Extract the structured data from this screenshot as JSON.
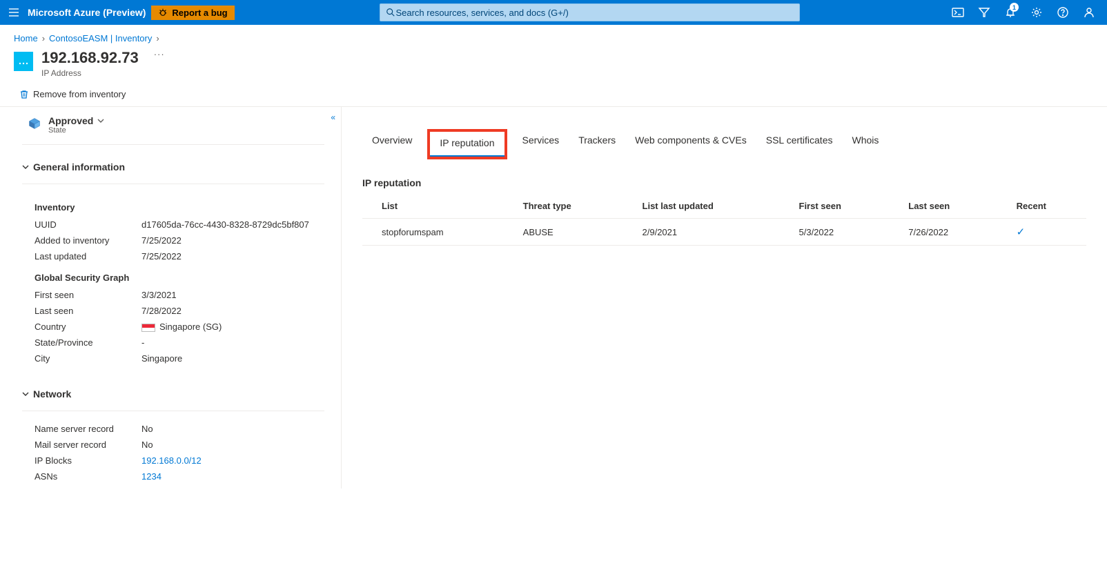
{
  "topbar": {
    "brand": "Microsoft Azure (Preview)",
    "bug_label": "Report a bug",
    "search_placeholder": "Search resources, services, and docs (G+/)",
    "notification_count": "1"
  },
  "breadcrumb": {
    "items": [
      "Home",
      "ContosoEASM | Inventory"
    ]
  },
  "page": {
    "title": "192.168.92.73",
    "subtitle": "IP Address",
    "remove_label": "Remove from inventory"
  },
  "state": {
    "value": "Approved",
    "label": "State"
  },
  "left": {
    "general_header": "General information",
    "inventory_header": "Inventory",
    "uuid_k": "UUID",
    "uuid_v": "d17605da-76cc-4430-8328-8729dc5bf807",
    "added_k": "Added to inventory",
    "added_v": "7/25/2022",
    "updated_k": "Last updated",
    "updated_v": "7/25/2022",
    "gsg_header": "Global Security Graph",
    "first_seen_k": "First seen",
    "first_seen_v": "3/3/2021",
    "last_seen_k": "Last seen",
    "last_seen_v": "7/28/2022",
    "country_k": "Country",
    "country_v": "Singapore (SG)",
    "stateprov_k": "State/Province",
    "stateprov_v": "-",
    "city_k": "City",
    "city_v": "Singapore",
    "network_header": "Network",
    "ns_k": "Name server record",
    "ns_v": "No",
    "ms_k": "Mail server record",
    "ms_v": "No",
    "ipb_k": "IP Blocks",
    "ipb_v": "192.168.0.0/12",
    "asn_k": "ASNs",
    "asn_v": "1234"
  },
  "tabs": {
    "overview": "Overview",
    "ip_rep": "IP reputation",
    "services": "Services",
    "trackers": "Trackers",
    "webcomp": "Web components & CVEs",
    "ssl": "SSL certificates",
    "whois": "Whois"
  },
  "panel": {
    "title": "IP reputation",
    "headers": [
      "List",
      "Threat type",
      "List last updated",
      "First seen",
      "Last seen",
      "Recent"
    ],
    "rows": [
      {
        "list": "stopforumspam",
        "threat": "ABUSE",
        "updated": "2/9/2021",
        "first": "5/3/2022",
        "last": "7/26/2022",
        "recent": true
      }
    ]
  }
}
